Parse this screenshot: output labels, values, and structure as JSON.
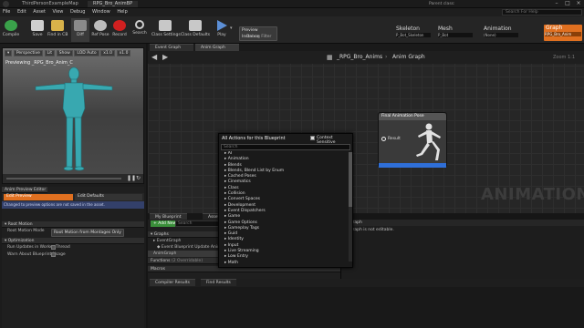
{
  "window": {
    "app_title": "ThirdPersonExampleMap",
    "tab_title": "RPG_Bro_AnimBP",
    "toolbar_tab": "Toolbar",
    "parent_class_label": "Parent class:",
    "parent_class_value": "Anim Instance",
    "search_help_placeholder": "Search For Help"
  },
  "menu_bar": [
    "File",
    "Edit",
    "Asset",
    "View",
    "Debug",
    "Window",
    "Help"
  ],
  "toolbar": {
    "buttons": [
      {
        "label": "Compile",
        "icon": "compile-icon",
        "color": "#3aa14a"
      },
      {
        "label": "Save",
        "icon": "save-icon",
        "color": "#cfcfcf"
      },
      {
        "label": "Find in CB",
        "icon": "find-in-cb-icon",
        "color": "#d8b24a"
      },
      {
        "label": "Diff",
        "icon": "diff-icon",
        "color": "#8a8a8a"
      },
      {
        "label": "Ref Pose",
        "icon": "ref-pose-icon",
        "color": "#bcbcbc"
      },
      {
        "label": "Record",
        "icon": "record-icon",
        "color": "#d02020"
      },
      {
        "label": "Search",
        "icon": "search-icon",
        "color": "#cfcfcf"
      },
      {
        "label": "Class Settings",
        "icon": "class-settings-icon",
        "color": "#c8c8c8"
      },
      {
        "label": "Class Defaults",
        "icon": "class-defaults-icon",
        "color": "#c8c8c8"
      },
      {
        "label": "Play",
        "icon": "play-icon",
        "color": "#5c8fd6"
      }
    ],
    "debug_select": "Preview Instance",
    "debug_filter_label": "Debug Filter"
  },
  "asset_modes": [
    {
      "label": "Skeleton",
      "sub": "P_Bot_Skeleton"
    },
    {
      "label": "Mesh",
      "sub": "P_Bot"
    },
    {
      "label": "Animation",
      "sub": "(None)"
    },
    {
      "label": "Graph",
      "sub": "RPG_Bro_Anim",
      "active": true
    }
  ],
  "viewport": {
    "buttons": [
      "Perspective",
      "Lit",
      "Show",
      "LOD Auto",
      "x1.0",
      "x1.0"
    ],
    "previewing_text": "Previewing _RPG_Bro_Anim_C"
  },
  "anim_preview": {
    "tab_label": "Anim Preview Editor",
    "edit_preview": "Edit Preview",
    "edit_defaults": "Edit Defaults",
    "info_text": "Changed to preview options are not saved in the asset.",
    "sections": [
      {
        "title": "Root Motion",
        "rows": [
          {
            "label": "Root Motion Mode",
            "value": "Root Motion from Montages Only"
          }
        ]
      },
      {
        "title": "Optimization",
        "rows": [
          {
            "label": "Run Updates in Worker Thread",
            "value": ""
          },
          {
            "label": "Warn About Blueprint Usage",
            "value": ""
          }
        ]
      }
    ]
  },
  "graph_tabs": [
    "Event Graph",
    "Anim Graph"
  ],
  "breadcrumb": {
    "asset": "_RPG_Bro_Anims",
    "graph": "Anim Graph",
    "zoom": "Zoom 1:1"
  },
  "final_pose_node": {
    "title": "Final Animation Pose",
    "pin_label": "Result"
  },
  "watermark": "ANIMATION",
  "actions_menu": {
    "title": "All Actions for this Blueprint",
    "context_sensitive": "Context Sensitive",
    "search_placeholder": "Search",
    "items": [
      "AI",
      "Animation",
      "Blends",
      "Blends, Blend List by Enum",
      "Cached Poses",
      "Cinematics",
      "Class",
      "Collision",
      "Convert Spaces",
      "Development",
      "Event Dispatchers",
      "Game",
      "Game Options",
      "Gameplay Tags",
      "Guid",
      "Identity",
      "Input",
      "Live Streaming",
      "Low Entry",
      "Math"
    ]
  },
  "my_blueprint": {
    "tabs": [
      "My Blueprint",
      "Asset Browser"
    ],
    "add_new": "Add New",
    "search_placeholder": "Search",
    "graphs_header": "Graphs",
    "graphs": [
      "EventGraph",
      "Event Blueprint Update Animation",
      "AnimGraph"
    ],
    "functions_label": "Functions",
    "functions_overridable": "(2 Overridable)",
    "macros_label": "Macros"
  },
  "details": {
    "header": "Graph",
    "message": "Graph is not editable."
  },
  "results_tabs": [
    "Compiler Results",
    "Find Results"
  ]
}
